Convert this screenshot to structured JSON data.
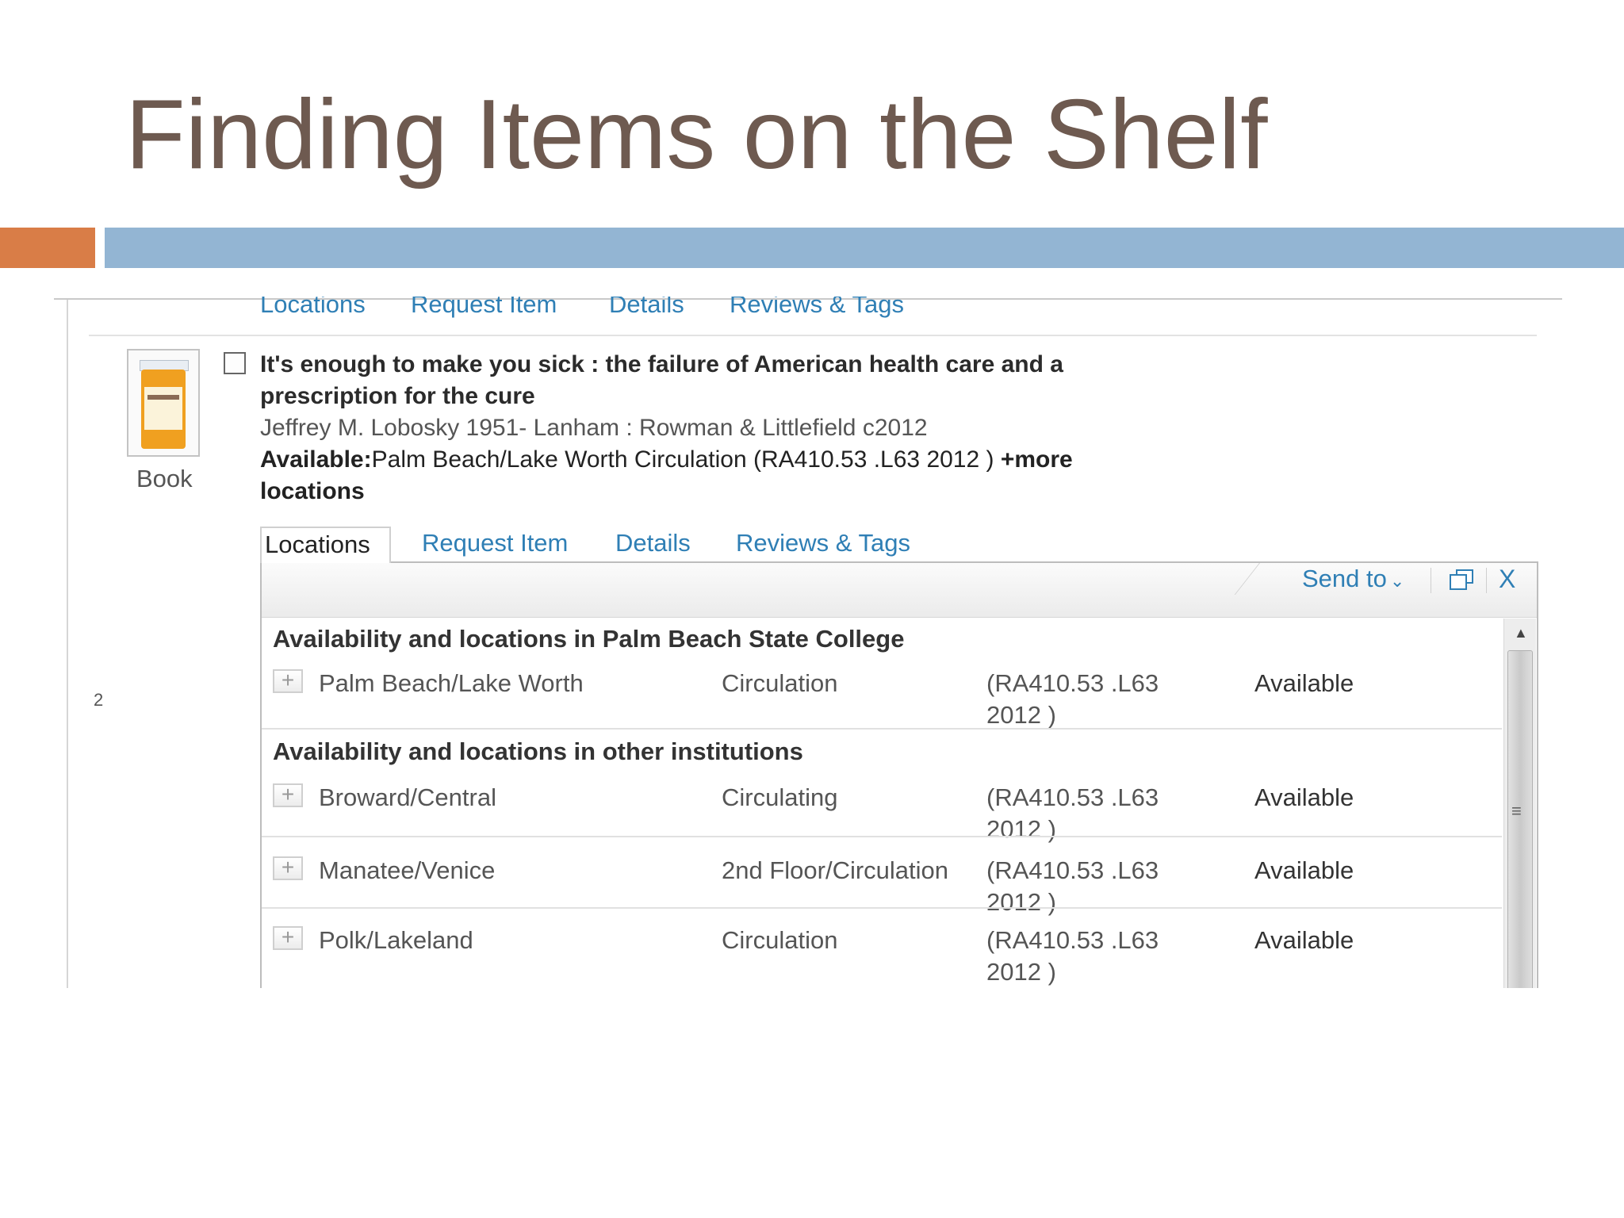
{
  "slide": {
    "title": "Finding Items on the Shelf",
    "colors": {
      "title": "#6e5a50",
      "accent_orange": "#d97d47",
      "accent_blue": "#93b5d3",
      "link": "#2f7fb5"
    }
  },
  "prev_record_tabs": [
    "Locations",
    "Request Item",
    "Details",
    "Reviews & Tags"
  ],
  "record": {
    "result_number": "2",
    "type_label": "Book",
    "title_line1": "It's enough to make you sick : the failure of American health care and a",
    "title_line2": "prescription for the cure",
    "author_line": "Jeffrey M. Lobosky 1951- Lanham : Rowman & Littlefield c2012",
    "availability_label": "Available:",
    "availability_text": "Palm Beach/Lake Worth Circulation (RA410.53 .L63 2012 )",
    "more_locations_part1": "+more",
    "more_locations_part2": "locations",
    "thumbnail_icon": "book-cover-pill-bottle-icon"
  },
  "tabs": [
    {
      "label": "Locations",
      "active": true
    },
    {
      "label": "Request Item",
      "active": false
    },
    {
      "label": "Details",
      "active": false
    },
    {
      "label": "Reviews & Tags",
      "active": false
    }
  ],
  "toolbar": {
    "send_to": "Send to",
    "send_to_icon": "chevron-down-icon",
    "popout_icon": "popout-window-icon",
    "close_label": "X"
  },
  "availability": {
    "home_heading": "Availability and locations in Palm Beach State College",
    "home_rows": [
      {
        "library": "Palm Beach/Lake Worth",
        "collection": "Circulation",
        "call_number": "(RA410.53 .L63 2012 )",
        "status": "Available"
      }
    ],
    "other_heading": "Availability and locations in other institutions",
    "other_rows": [
      {
        "library": "Broward/Central",
        "collection": "Circulating",
        "call_number": "(RA410.53 .L63 2012 )",
        "status": "Available"
      },
      {
        "library": "Manatee/Venice",
        "collection": "2nd Floor/Circulation",
        "call_number": "(RA410.53 .L63 2012 )",
        "status": "Available"
      },
      {
        "library": "Polk/Lakeland",
        "collection": "Circulation",
        "call_number": "(RA410.53 .L63 2012 )",
        "status": "Available"
      }
    ],
    "expand_symbol": "+"
  }
}
